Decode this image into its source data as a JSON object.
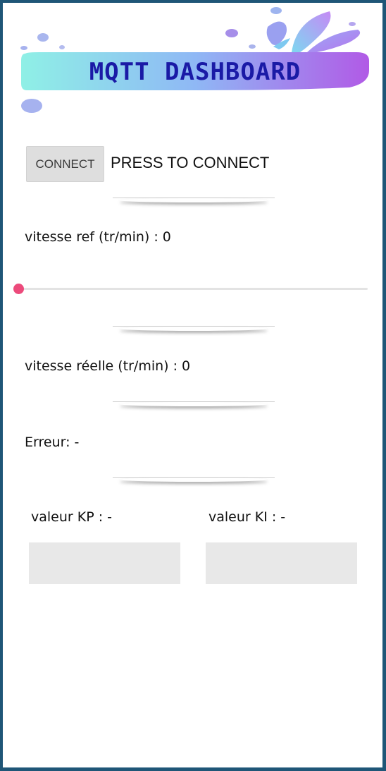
{
  "header": {
    "title": "MQTT DASHBOARD"
  },
  "connection": {
    "button_label": "CONNECT",
    "status_text": "PRESS TO CONNECT"
  },
  "speed_ref": {
    "label": "vitesse ref (tr/min) : 0",
    "slider_value": 0,
    "slider_min": 0,
    "slider_max": 100
  },
  "speed_real": {
    "label": "vitesse réelle (tr/min) : 0"
  },
  "error": {
    "label": "Erreur: -"
  },
  "kp": {
    "label": "valeur KP : -",
    "value": ""
  },
  "ki": {
    "label": "valeur KI : -",
    "value": ""
  },
  "colors": {
    "title": "#1a1aa6",
    "slider_accent": "#ec4a7b",
    "border": "#1f5677",
    "banner_start": "#8ff0e6",
    "banner_end": "#b15ae6"
  }
}
